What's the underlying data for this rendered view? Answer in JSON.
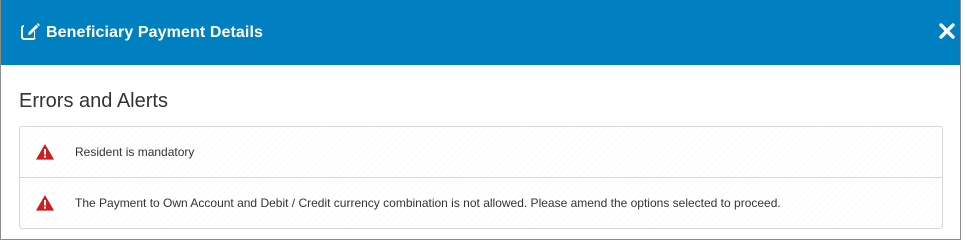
{
  "header": {
    "title": "Beneficiary Payment Details",
    "icon": "edit-icon",
    "close_icon": "close-icon",
    "background_color": "#0080c0"
  },
  "section": {
    "title": "Errors and Alerts"
  },
  "alerts": [
    {
      "icon": "warning-icon",
      "icon_color": "#cc1f1f",
      "message": "Resident is mandatory"
    },
    {
      "icon": "warning-icon",
      "icon_color": "#cc1f1f",
      "message": "The Payment to Own Account and Debit / Credit currency combination is not allowed. Please amend the options selected to proceed."
    }
  ]
}
